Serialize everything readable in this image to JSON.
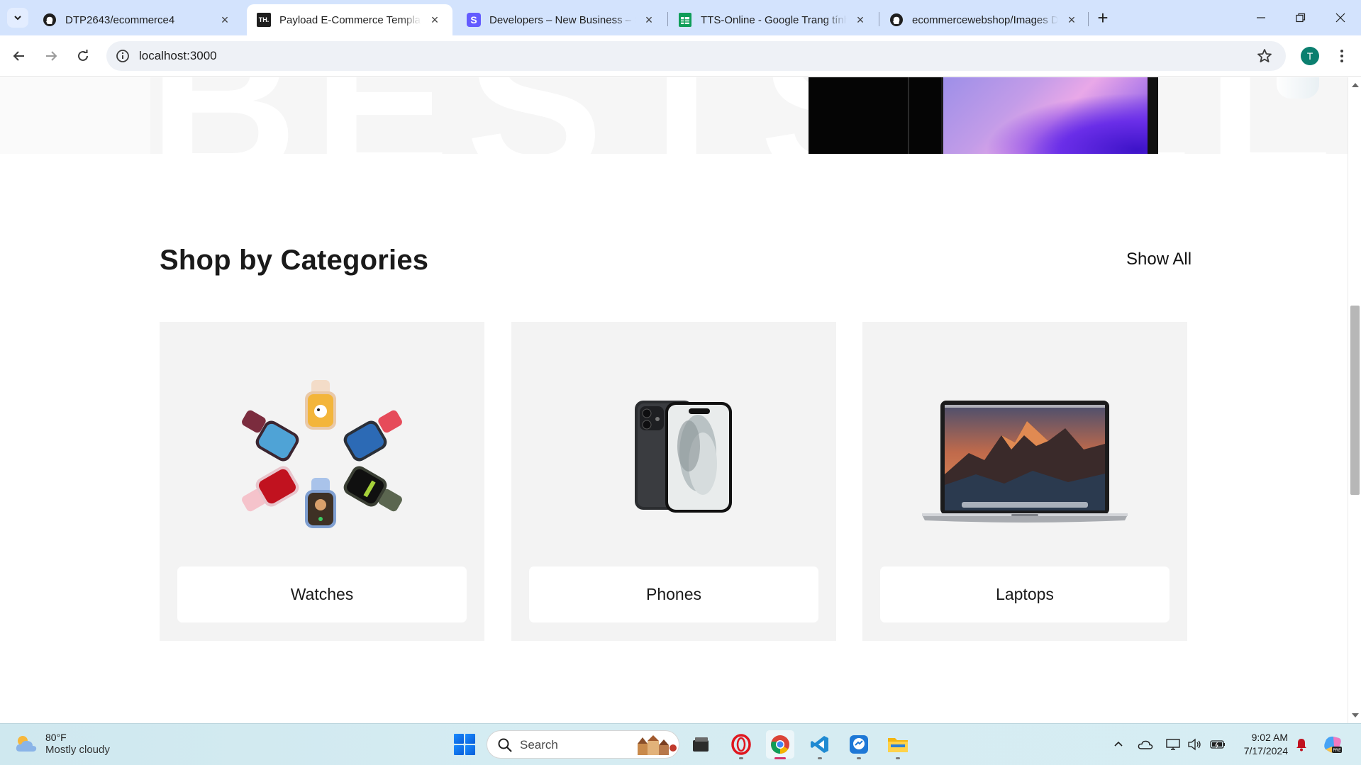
{
  "browser": {
    "tabs": [
      {
        "title": "DTP2643/ecommerce4",
        "icon": "github-icon",
        "active": false
      },
      {
        "title": "Payload E-Commerce Template",
        "icon": "th-logo-icon",
        "active": true
      },
      {
        "title": "Developers – New Business – St",
        "icon": "stripe-icon",
        "active": false
      },
      {
        "title": "TTS-Online - Google Trang tính",
        "icon": "google-sheets-icon",
        "active": false
      },
      {
        "title": "ecommercewebshop/Images D",
        "icon": "github-icon",
        "active": false
      }
    ],
    "url": "localhost:3000",
    "profile_initial": "T",
    "favicon_th_text": "TH."
  },
  "page": {
    "hero_background_word": "BESTSELLE",
    "section_title": "Shop by Categories",
    "show_all_label": "Show All",
    "categories": [
      {
        "label": "Watches",
        "image": "watches-image"
      },
      {
        "label": "Phones",
        "image": "phone-image"
      },
      {
        "label": "Laptops",
        "image": "laptop-image"
      }
    ]
  },
  "taskbar": {
    "weather_temp": "80°F",
    "weather_desc": "Mostly cloudy",
    "search_placeholder": "Search",
    "time": "9:02 AM",
    "date": "7/17/2024"
  },
  "colors": {
    "tabstrip": "#d3e3fd",
    "card_background": "#f3f3f3",
    "taskbar": "#d3ebf1"
  }
}
